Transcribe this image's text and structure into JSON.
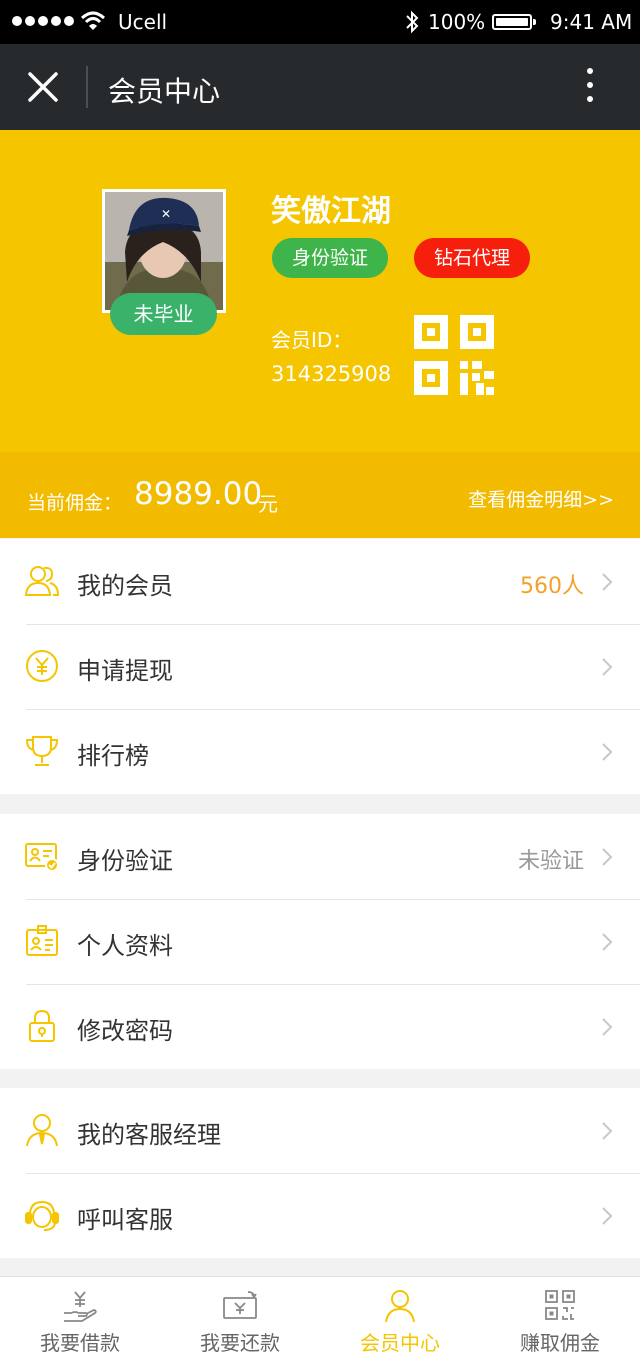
{
  "status_bar": {
    "carrier": "Ucell",
    "battery": "100%",
    "time": "9:41 AM"
  },
  "nav": {
    "title": "会员中心"
  },
  "profile": {
    "nickname": "笑傲江湖",
    "graduation_badge": "未毕业",
    "tags": {
      "identity": "身份验证",
      "agent_level": "钻石代理"
    },
    "member_id_label": "会员ID：",
    "member_id": "314325908"
  },
  "commission": {
    "label": "当前佣金：",
    "amount": "8989.00",
    "unit": "元",
    "detail_link": "查看佣金明细>>"
  },
  "groups": [
    [
      {
        "label": "我的会员",
        "value": "560人",
        "icon": "members-icon"
      },
      {
        "label": "申请提现",
        "value": "",
        "icon": "yuan-coin-icon"
      },
      {
        "label": "排行榜",
        "value": "",
        "icon": "trophy-icon"
      }
    ],
    [
      {
        "label": "身份验证",
        "value": "未验证",
        "icon": "id-card-verify-icon"
      },
      {
        "label": "个人资料",
        "value": "",
        "icon": "badge-profile-icon"
      },
      {
        "label": "修改密码",
        "value": "",
        "icon": "lock-icon"
      }
    ],
    [
      {
        "label": "我的客服经理",
        "value": "",
        "icon": "manager-icon"
      },
      {
        "label": "呼叫客服",
        "value": "",
        "icon": "headset-icon"
      }
    ]
  ],
  "tabs": [
    {
      "label": "我要借款",
      "icon": "loan-hand-icon",
      "active": false
    },
    {
      "label": "我要还款",
      "icon": "repay-cash-icon",
      "active": false
    },
    {
      "label": "会员中心",
      "icon": "member-person-icon",
      "active": true
    },
    {
      "label": "赚取佣金",
      "icon": "qr-code-icon",
      "active": false
    }
  ],
  "colors": {
    "accent": "#f5c600",
    "nav_bg": "#262a2d",
    "green": "#3fb44b",
    "red": "#f61e0c",
    "orange_value": "#f3a229"
  }
}
